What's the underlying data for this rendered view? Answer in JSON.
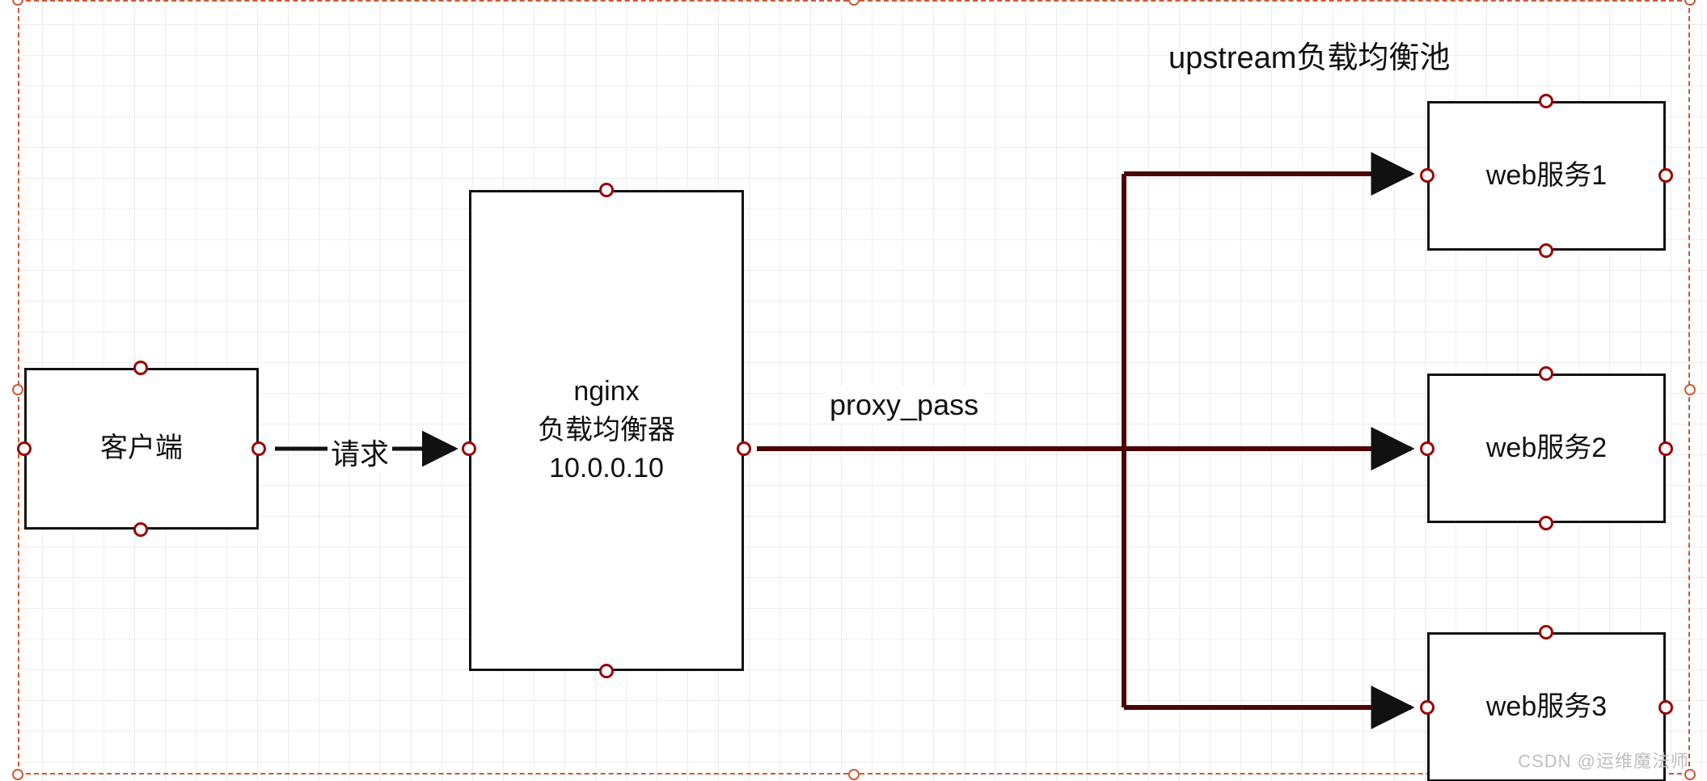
{
  "diagram": {
    "title_upstream": "upstream负载均衡池",
    "client": {
      "label": "客户端"
    },
    "request_label": "请求",
    "nginx": {
      "line1": "nginx",
      "line2": "负载均衡器",
      "line3": "10.0.0.10"
    },
    "proxy_pass_label": "proxy_pass",
    "webs": [
      {
        "label": "web服务1"
      },
      {
        "label": "web服务2"
      },
      {
        "label": "web服务3"
      }
    ]
  },
  "watermark": "CSDN @运维魔法师",
  "colors": {
    "wire": "#4a0606",
    "port_border": "#9a0404",
    "selection": "#cc5a33",
    "grid": "#ededed"
  }
}
